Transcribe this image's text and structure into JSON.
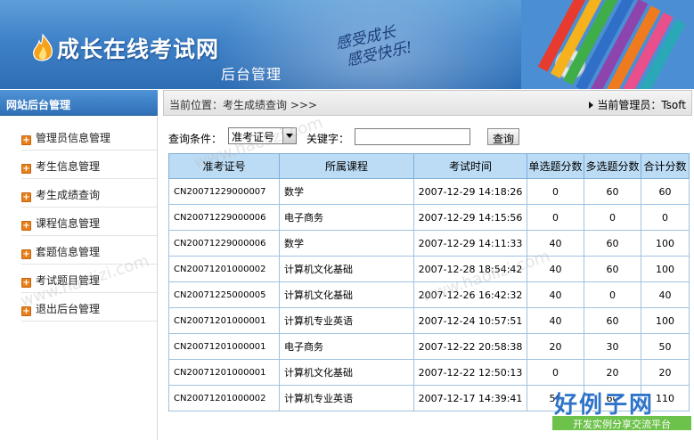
{
  "header": {
    "title": "成长在线考试网",
    "subtitle": "后台管理",
    "slogan_line1": "感受成长",
    "slogan_line2": "感受快乐!"
  },
  "sidebar": {
    "title": "网站后台管理",
    "items": [
      {
        "label": "管理员信息管理"
      },
      {
        "label": "考生信息管理"
      },
      {
        "label": "考生成绩查询"
      },
      {
        "label": "课程信息管理"
      },
      {
        "label": "套题信息管理"
      },
      {
        "label": "考试题目管理"
      },
      {
        "label": "退出后台管理"
      }
    ]
  },
  "breadcrumb": {
    "location": "当前位置：考生成绩查询 >>>",
    "admin": "当前管理员：Tsoft"
  },
  "search": {
    "condition_label": "查询条件：",
    "condition_value": "准考证号",
    "keyword_label": "关键字：",
    "keyword_value": "",
    "button_label": "查询"
  },
  "table": {
    "headers": [
      "准考证号",
      "所属课程",
      "考试时间",
      "单选题分数",
      "多选题分数",
      "合计分数"
    ],
    "rows": [
      [
        "CN20071229000007",
        "数学",
        "2007-12-29 14:18:26",
        "0",
        "60",
        "60"
      ],
      [
        "CN20071229000006",
        "电子商务",
        "2007-12-29 14:15:56",
        "0",
        "0",
        "0"
      ],
      [
        "CN20071229000006",
        "数学",
        "2007-12-29 14:11:33",
        "40",
        "60",
        "100"
      ],
      [
        "CN20071201000002",
        "计算机文化基础",
        "2007-12-28 18:54:42",
        "40",
        "60",
        "100"
      ],
      [
        "CN20071225000005",
        "计算机文化基础",
        "2007-12-26 16:42:32",
        "40",
        "0",
        "40"
      ],
      [
        "CN20071201000001",
        "计算机专业英语",
        "2007-12-24 10:57:51",
        "40",
        "60",
        "100"
      ],
      [
        "CN20071201000001",
        "电子商务",
        "2007-12-22 20:58:38",
        "20",
        "30",
        "50"
      ],
      [
        "CN20071201000001",
        "计算机文化基础",
        "2007-12-22 12:50:13",
        "0",
        "20",
        "20"
      ],
      [
        "CN20071201000002",
        "计算机专业英语",
        "2007-12-17 14:39:41",
        "50",
        "60",
        "110"
      ]
    ]
  },
  "watermark": {
    "text": "www.haolizi.com",
    "brand_main": "好例子网",
    "brand_sub": "开发实例分享交流平台"
  }
}
